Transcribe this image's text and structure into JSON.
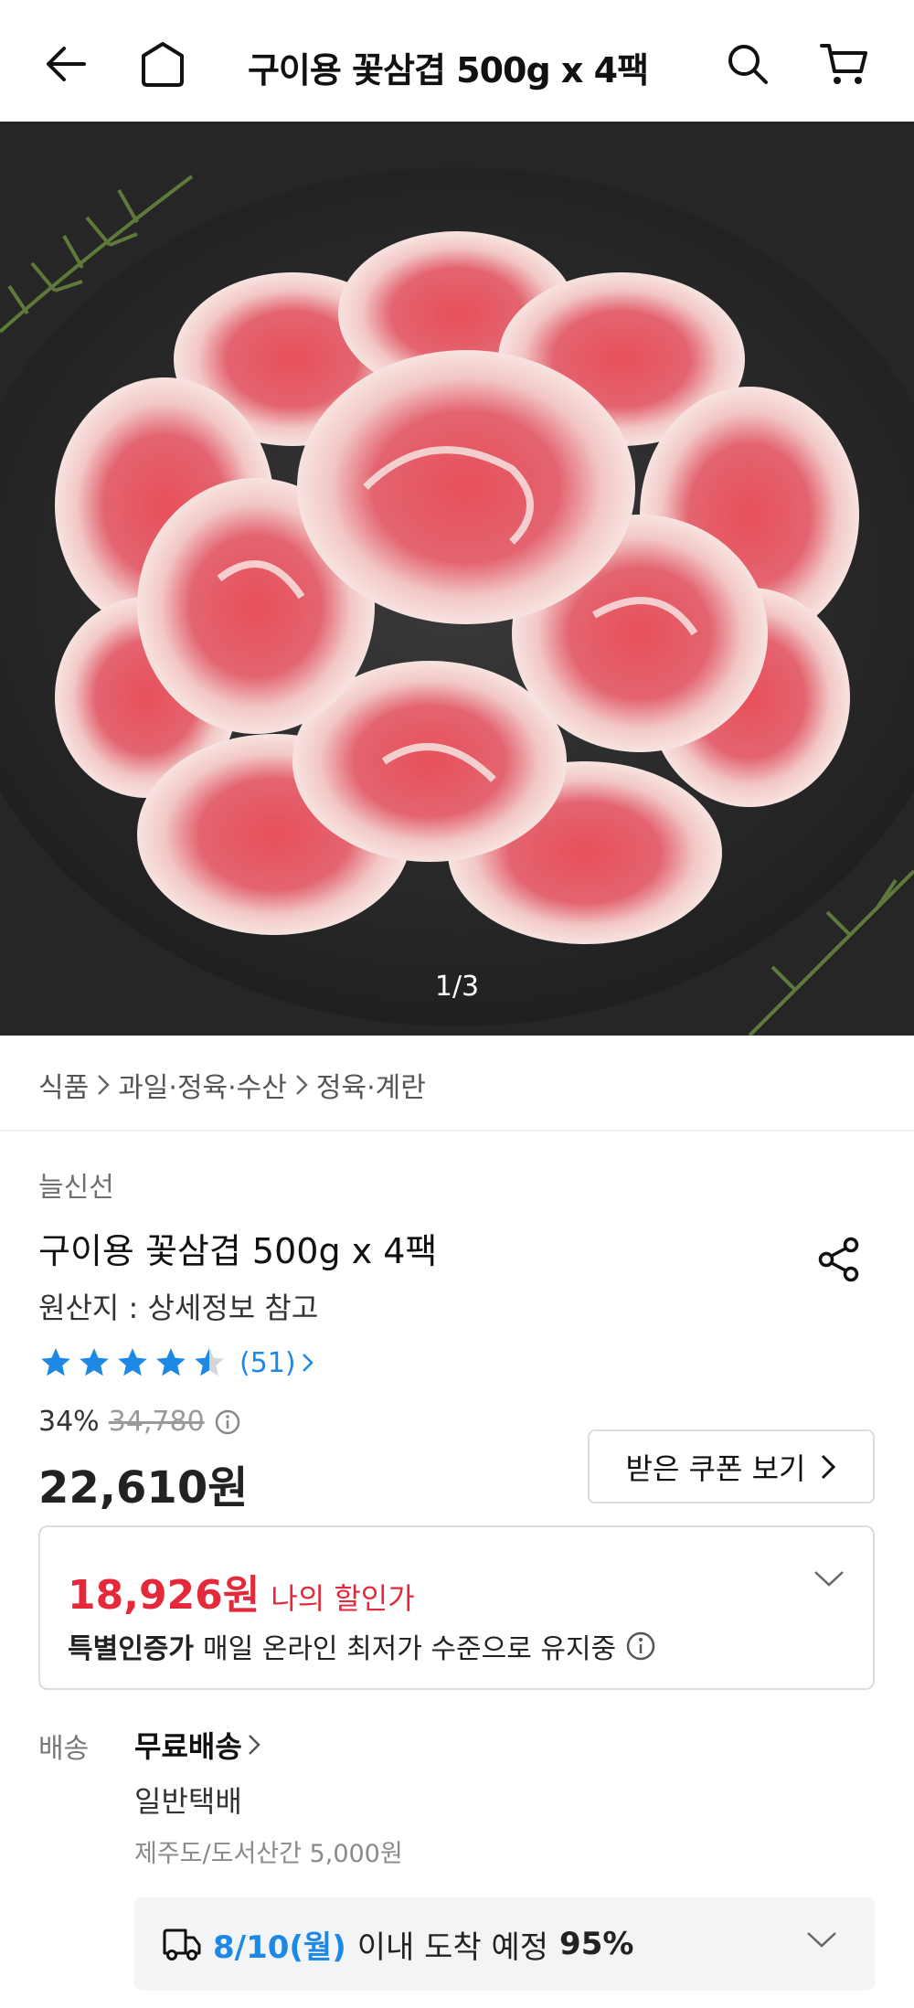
{
  "header": {
    "title": "구이용 꽃삼겹 500g x 4팩",
    "back_icon": "arrow-left-icon",
    "home_icon": "home-icon",
    "search_icon": "search-icon",
    "cart_icon": "cart-icon"
  },
  "gallery": {
    "counter": "1/3"
  },
  "breadcrumb": [
    "식품",
    "과일·정육·수산",
    "정육·계란"
  ],
  "product": {
    "brand": "늘신선",
    "name": "구이용 꽃삼겹 500g x 4팩",
    "origin": "원산지 : 상세정보 참고",
    "rating_value": 4.5,
    "review_count": "(51)",
    "discount_rate": "34%",
    "original_price": "34,780",
    "sale_price": "22,610원"
  },
  "coupon": {
    "label": "받은 쿠폰 보기"
  },
  "my_deal": {
    "price": "18,926원",
    "label": "나의 할인가",
    "badge": "특별인증가",
    "note": "매일 온라인 최저가 수준으로 유지중"
  },
  "shipping": {
    "label": "배송",
    "free": "무료배송",
    "method": "일반택배",
    "extra": "제주도/도서산간 5,000원",
    "eta_date": "8/10(월)",
    "eta_text": "이내 도착 예정",
    "eta_pct": "95%"
  },
  "colors": {
    "accent_blue": "#1e88e5",
    "deal_red": "#e5293b",
    "star_blue": "#1e88e5"
  }
}
